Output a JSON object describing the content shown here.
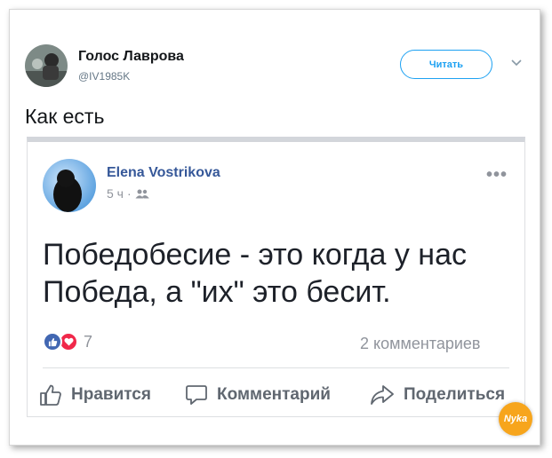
{
  "tweet": {
    "author_name": "Голос Лаврова",
    "author_handle": "@IV1985K",
    "follow_label": "Читать",
    "text": "Как есть"
  },
  "fb_post": {
    "author_name": "Elena Vostrikova",
    "time": "5 ч",
    "separator": "·",
    "privacy_icon": "friends-icon",
    "more_label": "•••",
    "text": "Победобесие - это когда у нас Победа, а \"их\" это бесит.",
    "reaction_count": "7",
    "comments_count": "2 комментариев",
    "actions": {
      "like": "Нравится",
      "comment": "Комментарий",
      "share": "Поделиться"
    }
  },
  "watermark": {
    "text": "Nyka"
  },
  "colors": {
    "twitter_blue": "#1da1f2",
    "fb_name": "#365899",
    "like": "#4267b2",
    "love": "#f0284a",
    "watermark": "#f7a51c"
  }
}
